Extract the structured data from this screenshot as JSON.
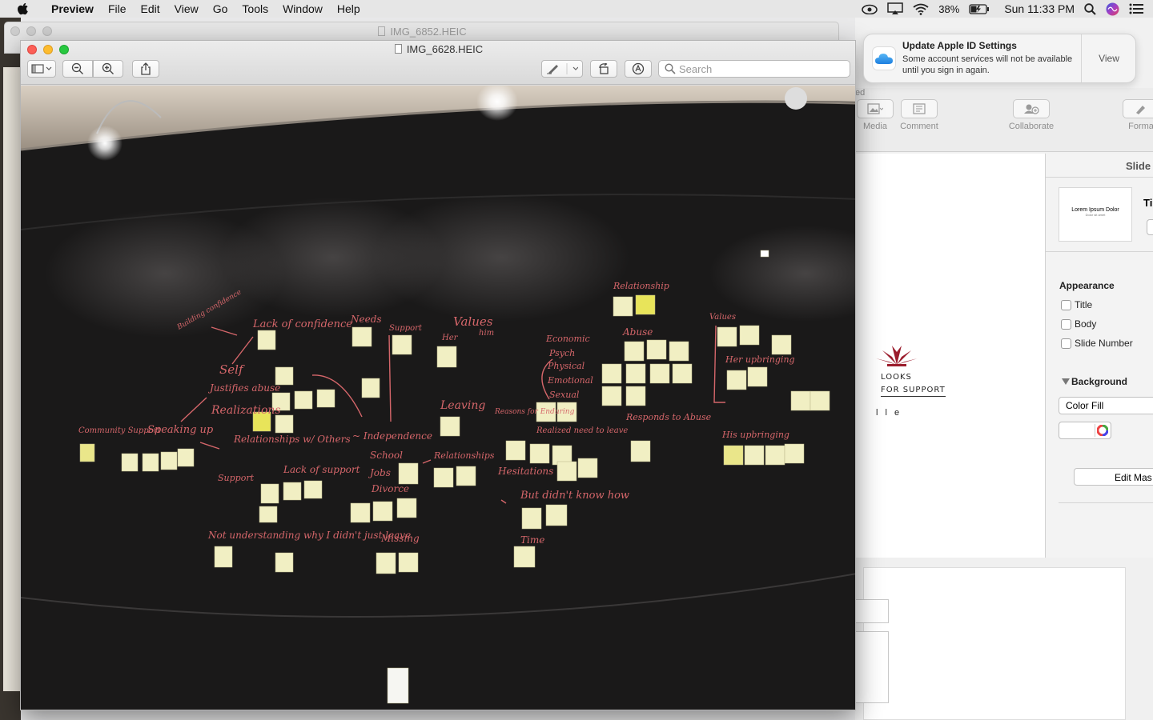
{
  "menubar": {
    "app": "Preview",
    "items": [
      "File",
      "Edit",
      "View",
      "Go",
      "Tools",
      "Window",
      "Help"
    ],
    "battery": "38%",
    "clock": "Sun 11:33 PM"
  },
  "back_window": {
    "title": "IMG_6852.HEIC"
  },
  "window": {
    "title": "IMG_6628.HEIC",
    "search_placeholder": "Search"
  },
  "notification": {
    "title": "Update Apple ID Settings",
    "body": "Some account services will not be available until you sign in again.",
    "action": "View"
  },
  "keynote": {
    "toolbar_partial": "ed",
    "tools": [
      {
        "label": "Media",
        "icon": "media-icon"
      },
      {
        "label": "Comment",
        "icon": "comment-icon"
      },
      {
        "label": "Collaborate",
        "icon": "collaborate-icon"
      },
      {
        "label": "Forma",
        "icon": "format-icon"
      }
    ],
    "slide_text": {
      "line1": "LOOKS",
      "line2": "FOR SUPPORT",
      "line3": "l l e"
    },
    "inspector": {
      "header": "Slide I",
      "thumbnail_title": "Lorem Ipsum Dolor",
      "thumbnail_sub": "Dolor sit amet",
      "title_partial": "Ti",
      "appearance_label": "Appearance",
      "checkboxes": [
        "Title",
        "Body",
        "Slide Number"
      ],
      "background_label": "Background",
      "fill_value": "Color Fill",
      "edit_master_label": "Edit Mas"
    }
  },
  "whiteboard": {
    "labels": [
      "Lack of confidence",
      "Self",
      "Justifies abuse",
      "Realizations",
      "Community Support",
      "Speaking up",
      "Relationships w/ Others",
      "Lack of support",
      "Support",
      "Not understanding why I didn't just leave",
      "Needs",
      "Support",
      "Values",
      "Her",
      "him",
      "~ Independence",
      "Leaving",
      "School",
      "Jobs",
      "Divorce",
      "Relationships",
      "Missing",
      "Reasons for Enduring",
      "Realized need to leave",
      "Hesitations",
      "But didn't know how",
      "Time",
      "Economic",
      "Psych",
      "Physical",
      "Emotional",
      "Sexual",
      "Relationship",
      "Abuse",
      "Responds to Abuse",
      "Values",
      "Her upbringing",
      "His upbringing",
      "Building confidence"
    ]
  }
}
